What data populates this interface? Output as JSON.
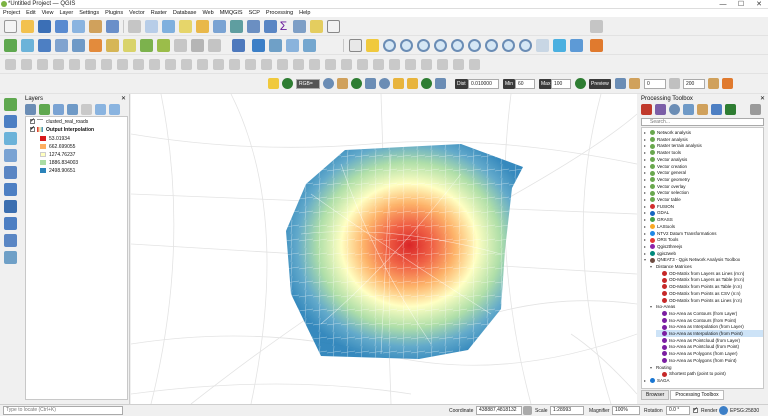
{
  "window": {
    "title": "*Untitled Project — QGIS",
    "minimize": "—",
    "maximize": "☐",
    "close": "✕"
  },
  "menu": [
    "Project",
    "Edit",
    "View",
    "Layer",
    "Settings",
    "Plugins",
    "Vector",
    "Raster",
    "Database",
    "Web",
    "MMQGIS",
    "SCP",
    "Processing",
    "Help"
  ],
  "scp_toolbar": {
    "band_value": "RGB=",
    "dist_label": "Dist",
    "dist_value": "0.010000",
    "min_label": "Min",
    "min_value": "60",
    "max_label": "Max",
    "max_value": "100",
    "preview_label": "Preview",
    "field_a": "0",
    "field_b": "200"
  },
  "layers_panel": {
    "title": "Layers",
    "layers": [
      {
        "name": "clusted_real_roads",
        "checked": true,
        "bold": false
      },
      {
        "name": "Output Interpolation",
        "checked": true,
        "bold": true
      }
    ],
    "legend": [
      {
        "label": "53.01934",
        "color": "#d7191c"
      },
      {
        "label": "662.699055",
        "color": "#fdae61"
      },
      {
        "label": "1274.76237",
        "color": "#ffffbf"
      },
      {
        "label": "1886.834003",
        "color": "#abdda4"
      },
      {
        "label": "2498.90651",
        "color": "#2b83ba"
      }
    ]
  },
  "toolbox": {
    "title": "Processing Toolbox",
    "search_placeholder": "Search...",
    "items": [
      {
        "label": "Network analysis",
        "level": 0,
        "arrow": "▸",
        "color": "#6aa84f"
      },
      {
        "label": "Raster analysis",
        "level": 0,
        "arrow": "▸",
        "color": "#6aa84f"
      },
      {
        "label": "Raster terrain analysis",
        "level": 0,
        "arrow": "▸",
        "color": "#6aa84f"
      },
      {
        "label": "Raster tools",
        "level": 0,
        "arrow": "▸",
        "color": "#6aa84f"
      },
      {
        "label": "Vector analysis",
        "level": 0,
        "arrow": "▸",
        "color": "#6aa84f"
      },
      {
        "label": "Vector creation",
        "level": 0,
        "arrow": "▸",
        "color": "#6aa84f"
      },
      {
        "label": "Vector general",
        "level": 0,
        "arrow": "▸",
        "color": "#6aa84f"
      },
      {
        "label": "Vector geometry",
        "level": 0,
        "arrow": "▸",
        "color": "#6aa84f"
      },
      {
        "label": "Vector overlay",
        "level": 0,
        "arrow": "▸",
        "color": "#6aa84f"
      },
      {
        "label": "Vector selection",
        "level": 0,
        "arrow": "▸",
        "color": "#6aa84f"
      },
      {
        "label": "Vector table",
        "level": 0,
        "arrow": "▸",
        "color": "#6aa84f"
      },
      {
        "label": "FUSION",
        "level": 0,
        "arrow": "▸",
        "color": "#d32f2f"
      },
      {
        "label": "GDAL",
        "level": 0,
        "arrow": "▸",
        "color": "#1565c0"
      },
      {
        "label": "GRASS",
        "level": 0,
        "arrow": "▸",
        "color": "#43a047"
      },
      {
        "label": "LAStools",
        "level": 0,
        "arrow": "▸",
        "color": "#f9a825"
      },
      {
        "label": "NTV2 Datum Transformations",
        "level": 0,
        "arrow": "▸",
        "color": "#1e88e5"
      },
      {
        "label": "ORS Tools",
        "level": 0,
        "arrow": "▸",
        "color": "#e53935"
      },
      {
        "label": "Qgis2threejs",
        "level": 0,
        "arrow": "▸",
        "color": "#8e24aa"
      },
      {
        "label": "qgis2web",
        "level": 0,
        "arrow": "▸",
        "color": "#00897b"
      },
      {
        "label": "QNEAT3 - Qgis Network Analysis Toolbox",
        "level": 0,
        "arrow": "▾",
        "color": "#6d4c41"
      },
      {
        "label": "Distance Matrices",
        "level": 1,
        "arrow": "▾",
        "color": ""
      },
      {
        "label": "OD-Matrix from Layers as Lines (m:n)",
        "level": 2,
        "arrow": "",
        "color": "#c62828"
      },
      {
        "label": "OD-Matrix from Layers as Table (m:n)",
        "level": 2,
        "arrow": "",
        "color": "#c62828"
      },
      {
        "label": "OD-Matrix from Points as Table (n:n)",
        "level": 2,
        "arrow": "",
        "color": "#c62828"
      },
      {
        "label": "OD-Matrix from Points as CSV (n:n)",
        "level": 2,
        "arrow": "",
        "color": "#c62828"
      },
      {
        "label": "OD-Matrix from Points as Lines (n:n)",
        "level": 2,
        "arrow": "",
        "color": "#c62828"
      },
      {
        "label": "Iso-Areas",
        "level": 1,
        "arrow": "▾",
        "color": ""
      },
      {
        "label": "Iso-Area as Contours (from Layer)",
        "level": 2,
        "arrow": "",
        "color": "#7b1fa2"
      },
      {
        "label": "Iso-Area as Contours (from Point)",
        "level": 2,
        "arrow": "",
        "color": "#7b1fa2"
      },
      {
        "label": "Iso-Area as Interpolation (from Layer)",
        "level": 2,
        "arrow": "",
        "color": "#7b1fa2"
      },
      {
        "label": "Iso-Area as Interpolation (from Point)",
        "level": 2,
        "arrow": "",
        "color": "#7b1fa2",
        "selected": true
      },
      {
        "label": "Iso-Area as Pointcloud (from Layer)",
        "level": 2,
        "arrow": "",
        "color": "#7b1fa2"
      },
      {
        "label": "Iso-Area as Pointcloud (from Point)",
        "level": 2,
        "arrow": "",
        "color": "#7b1fa2"
      },
      {
        "label": "Iso-Area as Polygons (from Layer)",
        "level": 2,
        "arrow": "",
        "color": "#7b1fa2"
      },
      {
        "label": "Iso-Area as Polygons (from Point)",
        "level": 2,
        "arrow": "",
        "color": "#7b1fa2"
      },
      {
        "label": "Routing",
        "level": 1,
        "arrow": "▾",
        "color": ""
      },
      {
        "label": "Shortest path (point to point)",
        "level": 2,
        "arrow": "",
        "color": "#c62828"
      },
      {
        "label": "SAGA",
        "level": 0,
        "arrow": "▸",
        "color": "#1976d2"
      }
    ],
    "tabs": [
      "Browser",
      "Processing Toolbox"
    ]
  },
  "status": {
    "locator_placeholder": "Type to locate (Ctrl+K)",
    "coordinate_label": "Coordinate",
    "coordinate_value": "438887,4818132",
    "scale_label": "Scale",
    "scale_value": "1:28993",
    "magnifier_label": "Magnifier",
    "magnifier_value": "100%",
    "rotation_label": "Rotation",
    "rotation_value": "0.0 °",
    "render_label": "Render",
    "crs": "EPSG:25830"
  },
  "heatmap": {
    "low_color": "#2b83ba",
    "mid_color": "#ffffbf",
    "high_color": "#d7191c"
  }
}
